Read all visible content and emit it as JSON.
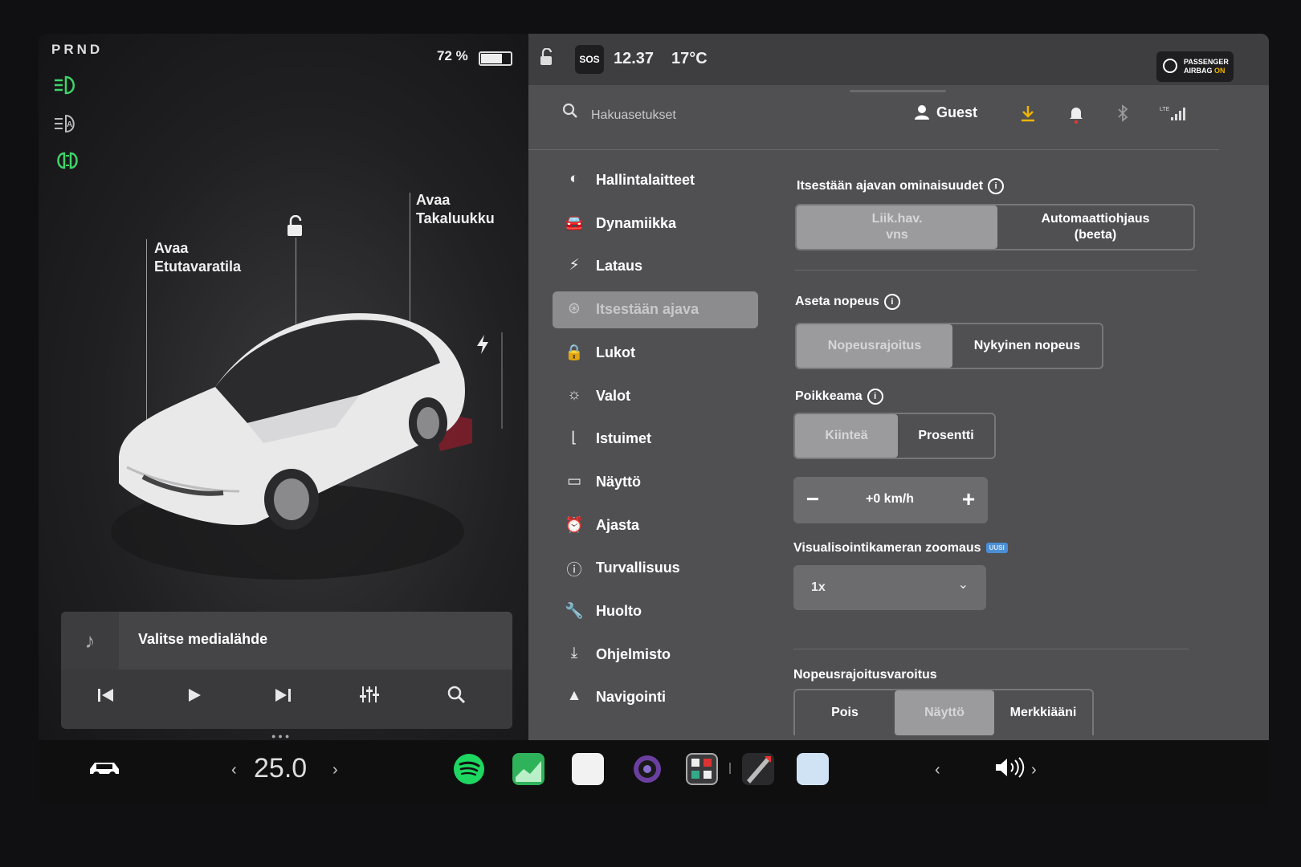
{
  "drive": {
    "gear": "PRND",
    "battery_pct": "72 %",
    "battery_level": 0.72
  },
  "car": {
    "frunk_label": "Avaa\nEtutavaratila",
    "trunk_label": "Avaa\nTakaluukku"
  },
  "media": {
    "source_label": "Valitse medialähde"
  },
  "status": {
    "clock": "12.37",
    "temp": "17°C",
    "sos": "SOS",
    "airbag_line1": "PASSENGER",
    "airbag_line2": "AIRBAG",
    "airbag_state": "ON"
  },
  "header": {
    "search_placeholder": "Hakuasetukset",
    "profile": "Guest",
    "network": "LTE"
  },
  "nav": {
    "items": [
      {
        "label": "Hallintalaitteet",
        "icon": "toggle-icon"
      },
      {
        "label": "Dynamiikka",
        "icon": "car-icon"
      },
      {
        "label": "Lataus",
        "icon": "bolt-icon"
      },
      {
        "label": "Itsestään ajava",
        "icon": "steering-wheel-icon",
        "active": true
      },
      {
        "label": "Lukot",
        "icon": "lock-icon"
      },
      {
        "label": "Valot",
        "icon": "sun-icon"
      },
      {
        "label": "Istuimet",
        "icon": "seat-icon"
      },
      {
        "label": "Näyttö",
        "icon": "display-icon"
      },
      {
        "label": "Ajasta",
        "icon": "alarm-icon"
      },
      {
        "label": "Turvallisuus",
        "icon": "alert-icon"
      },
      {
        "label": "Huolto",
        "icon": "wrench-icon"
      },
      {
        "label": "Ohjelmisto",
        "icon": "download-icon"
      },
      {
        "label": "Navigointi",
        "icon": "navigation-icon"
      }
    ]
  },
  "autopilot": {
    "features_title": "Itsestään ajavan ominaisuudet",
    "features_options": [
      "Liik.hav.\nvns",
      "Automaattiohjaus\n(beeta)"
    ],
    "set_speed_title": "Aseta nopeus",
    "set_speed_options": [
      "Nopeusrajoitus",
      "Nykyinen nopeus"
    ],
    "offset_title": "Poikkeama",
    "offset_options": [
      "Kiinteä",
      "Prosentti"
    ],
    "offset_value": "+0 km/h",
    "zoom_title": "Visualisointikameran zoomaus",
    "zoom_badge": "UUSI",
    "zoom_value": "1x",
    "warning_title": "Nopeusrajoitusvaroitus",
    "warning_options": [
      "Pois",
      "Näyttö",
      "Merkkiääni"
    ]
  },
  "taskbar": {
    "temperature": "25.0"
  },
  "colors": {
    "accent_green": "#3fd46a",
    "download_yellow": "#f0b400",
    "selected_segment": "#9b9b9e",
    "panel_bg": "#505053"
  }
}
